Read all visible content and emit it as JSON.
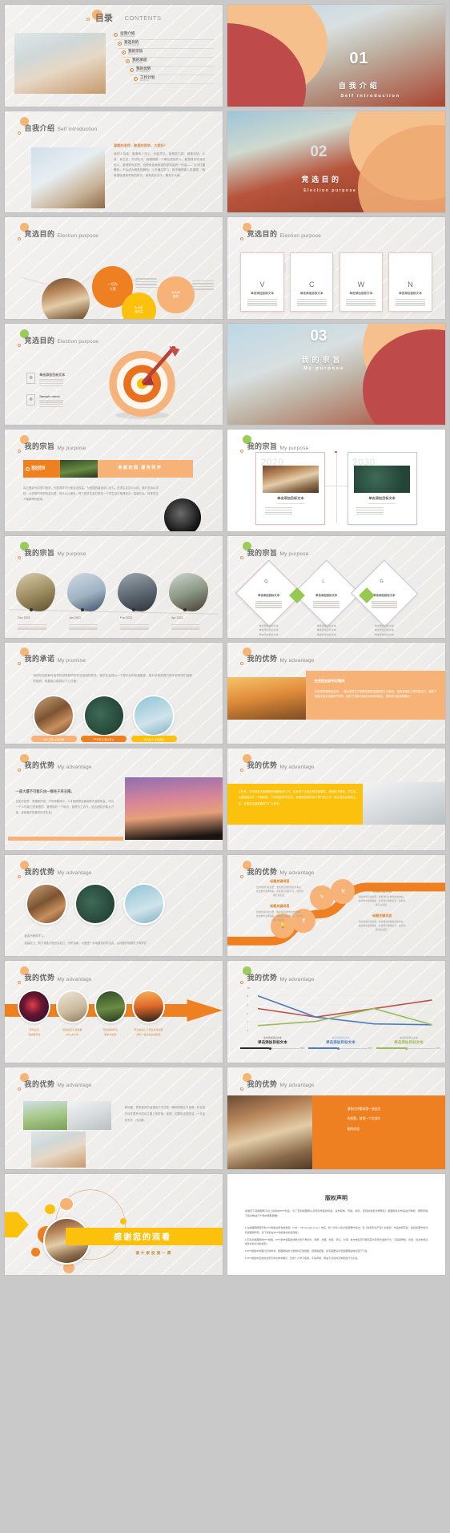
{
  "page": {
    "background": "#c9c9c9",
    "slide_bg": "#efeeec",
    "accent_orange": "#ef8022",
    "accent_light_orange": "#f7b377",
    "accent_yellow": "#fcc10d",
    "accent_green": "#96c94f",
    "accent_red": "#bf4a4a",
    "columns": 2,
    "slide_count": 28
  },
  "placeholder": {
    "target_text": "单击添加目标文本",
    "sample_name": "Sample name",
    "keyword": "标题关键词语",
    "percent": "58%"
  },
  "slides": [
    {
      "id": "s01-contents",
      "title_cn": "目录",
      "title_en": "CONTENTS",
      "items": [
        {
          "cn": "自我介绍",
          "en": "Self introduction"
        },
        {
          "cn": "竞选目的",
          "en": "Election purpose"
        },
        {
          "cn": "我的宗旨",
          "en": "My purpose"
        },
        {
          "cn": "我的承诺",
          "en": "My promise"
        },
        {
          "cn": "我的优势",
          "en": "My advantage"
        },
        {
          "cn": "工作计划",
          "en": "Work plan"
        }
      ]
    },
    {
      "id": "s02-section-01",
      "number": "01",
      "title_cn": "自我介绍",
      "title_en": "Self introduction"
    },
    {
      "id": "s03-self-intro",
      "title_cn": "自我介绍",
      "title_en": "Self introduction",
      "lead": "尊敬的老师，敬爱的同学，大家好！",
      "body": "我的人真诚，做事有上进心，头脑灵活，接受能力强，做事自信、认真，有主见，不怕吃亏，我懂得做一个事业成功的人，能带快乐给身边的人。爱得很有意思，也是促使我有强烈求知欲的一句话——“玉不打磨雕刻，不会成为精美的器物；人不通过学习，就不懂得做人的道理。”我希望能把我学到的知识，用到实际当中，服务于大家。"
    },
    {
      "id": "s04-purpose-circles",
      "title_cn": "竞选目的",
      "title_en": "Election purpose",
      "bubbles": [
        {
          "cn": "一切为\n大家",
          "color": "#ef8022"
        },
        {
          "cn": "为大家\n服务",
          "color": "#f7b377"
        },
        {
          "cn": "为大家\n谋利益",
          "color": "#fcc10d"
        }
      ]
    },
    {
      "id": "s05-purpose-vcwn",
      "title_cn": "竞选目的",
      "title_en": "Election purpose",
      "cards": [
        {
          "letter": "V",
          "ghost": "01",
          "label": "单击添加目标文本"
        },
        {
          "letter": "C",
          "ghost": "02",
          "label": "单击添加目标文本"
        },
        {
          "letter": "W",
          "ghost": "03",
          "label": "单击添加目标文本"
        },
        {
          "letter": "N",
          "ghost": "04",
          "label": "单击添加目标文本"
        }
      ]
    },
    {
      "id": "s06-purpose-target",
      "title_cn": "竞选目的",
      "title_en": "Election purpose",
      "rows": [
        {
          "label": "单击添加目标文本"
        },
        {
          "label": "Sample name"
        }
      ]
    },
    {
      "id": "s07-section-03",
      "number": "03",
      "title_cn": "我的宗旨",
      "title_en": "My purpose"
    },
    {
      "id": "s08-my-purpose-banner",
      "title_cn": "我的宗旨",
      "title_en": "My purpose",
      "badge_cn": "我的宗旨",
      "badge_en": "My purpose",
      "banner_text": "奉献校园   服务同学",
      "body": "真正做到为同学们服务，代表同学们行使合法权益，为校园的建设尽心尽力。在学生会意义以前，我们坚持以学校、大多数同学的利益为重，绝不以公谋私，努力把学生会打造成一个学生自己管理自己、高度自治、体现学生人格精神的团体。"
    },
    {
      "id": "s09-timeline-2020",
      "title_cn": "我的宗旨",
      "title_en": "My purpose",
      "panels": [
        {
          "year": "2020",
          "label": "单击添加目标文本"
        },
        {
          "year": "2030",
          "label": "单击添加目标文本"
        }
      ]
    },
    {
      "id": "s10-photo-timeline",
      "title_cn": "我的宗旨",
      "title_en": "My purpose",
      "points": [
        {
          "date": "Dec 2021"
        },
        {
          "date": "Jan 2021"
        },
        {
          "date": "Feb 2021"
        },
        {
          "date": "Apr 2021"
        }
      ]
    },
    {
      "id": "s11-diamonds-qlg",
      "title_cn": "我的宗旨",
      "title_en": "My purpose",
      "diamonds": [
        {
          "letter": "Q",
          "label": "单击添加目标文本"
        },
        {
          "letter": "L",
          "label": "单击添加目标文本"
        },
        {
          "letter": "G",
          "label": "单击添加目标文本"
        }
      ]
    },
    {
      "id": "s12-promise",
      "title_cn": "我的承诺",
      "title_en": "My promise",
      "body": "我将尽全校和完成学校领导和同学们交给我的任务，使学生会成为一个现代化的积极团体，成为学校的得力助手和同学们信赖的组织，我要用心做到以下几方面：",
      "tags": [
        {
          "text": "待人正直 以正为重",
          "color": "#f7b377"
        },
        {
          "text": "严于利己 宽以待人",
          "color": "#ef8022"
        },
        {
          "text": "乐于助人 甘任重任",
          "color": "#fcc10d"
        }
      ]
    },
    {
      "id": "s13-advantage-orange",
      "title_cn": "我的优势",
      "title_en": "My advantage",
      "panel_title": "在任团支部书记期间",
      "panel_body": "20多项的辩明各活动，一直对我学生干部教育委的加强服务工作热情，提高我落实工作的能动力，锻炼了我独才能主动服务于同学，锻炼了我搞才能成为同学的朋友，更有成为老师的助手！"
    },
    {
      "id": "s14-advantage-pillar",
      "title_cn": "我的优势",
      "title_en": "My advantage",
      "lead": "一座大厦不可能只由一根柱子来支撑。",
      "body": "正如马克思，恩格斯所说，只有再集体中，人才能获得全面发展才能的机会。可见一个人的能力是有限的，要想搞好一个组织，就得分工合作，结合团队的最大力量，进而更好的建设好学生会！"
    },
    {
      "id": "s15-advantage-yellow",
      "title_cn": "我的优势",
      "title_en": "My advantage",
      "body": "三年来，我不进办方面能很好地解我的工作，还负责了大部分的班级事务。我深刻了解到，学生会主席就相当于一只领航员，只有组织好学生会，协调和协调好各个部门的工作，用心完成自身的工作，才能真正做到服务于广大同学。"
    },
    {
      "id": "s16-advantage-circles3",
      "title_cn": "我的优势",
      "title_en": "My advantage",
      "body_line1": "我会不断的学习。",
      "body_line2": "武装自己，努力将各方面充实自己，开拓创新，以便进一步地建设好学生会，从而更好地服务于同学们"
    },
    {
      "id": "s17-advantage-wave",
      "title_cn": "我的优势",
      "title_en": "My advantage",
      "nodes": [
        {
          "icon": "pen-icon",
          "title": "标题关键词语",
          "body": "您的内容打在这里，或者通过复制您的文本后，在此框中选择粘贴，并选择只保留文字，您的内容打在这里。"
        },
        {
          "icon": "wrench-icon",
          "title": "标题关键词语",
          "body": "您的内容打在这里，或者通过复制您的文本后，在此框中选择粘贴，并选择只保留文字，您的内容打在这里。"
        },
        {
          "icon": "bulb-icon",
          "title": "标题关键词语",
          "body": "您的内容打在这里，或者通过复制您的文本后，在此框中选择粘贴，并选择只保留文字，您的内容打在这里。"
        },
        {
          "icon": "hourglass-icon",
          "title": "标题关键词语",
          "body": "您的内容打在这里，或者通过复制您的文本后，在此框中选择粘贴，并选择只保留文字，您的内容打在这里。"
        }
      ]
    },
    {
      "id": "s18-advantage-arrow",
      "title_cn": "我的优势",
      "title_en": "My advantage",
      "steps": [
        {
          "line1": "既然是花",
          "line2": "我就要开放"
        },
        {
          "line1": "既然是石头我就要",
          "line2": "去外出大海"
        },
        {
          "line1": "既然是树我就",
          "line2": "要长成栋梁"
        },
        {
          "line1": "既然是加入了学生会我就要",
          "line2": "成为一名出色的领航员"
        }
      ]
    },
    {
      "id": "s19-advantage-chart",
      "title_cn": "我的优势",
      "title_en": "My advantage",
      "legend": [
        {
          "small": "单击添加目标文本",
          "big": "单击添加目标文本",
          "pct": "58%",
          "color": "#2b2b2b"
        },
        {
          "small": "单击添加目标文本",
          "big": "单击添加目标文本",
          "pct": "58%",
          "color": "#4a7ebb"
        },
        {
          "small": "单击添加目标文本",
          "big": "单击添加目标文本",
          "pct": "58%",
          "color": "#9bbb59"
        }
      ],
      "chart_data": {
        "type": "line",
        "title": "",
        "xlabel": "",
        "ylabel": "",
        "x": [
          1,
          2,
          3,
          4
        ],
        "ylim": [
          0,
          10
        ],
        "yticks": [
          0,
          2,
          4,
          6,
          8,
          10
        ],
        "grid": true,
        "legend_position": "bottom",
        "series": [
          {
            "name": "单击添加目标文本",
            "color": "#c0504d",
            "values": [
              5,
              3,
              5,
              7
            ]
          },
          {
            "name": "单击添加目标文本",
            "color": "#4a7ebb",
            "values": [
              8,
              3,
              1.4,
              1.2
            ]
          },
          {
            "name": "单击添加目标文本",
            "color": "#9bbb59",
            "values": [
              1,
              2,
              5,
              1.2
            ]
          }
        ]
      }
    },
    {
      "id": "s20-advantage-photos",
      "title_cn": "我的优势",
      "title_en": "My advantage",
      "body": "我知道，再多豪言的话语也只不过是一瞬间的雄壮与激情，朴实的行动才是开创成功之路上的阶梯。我想，如果我当选的话，一定会言不托，行必果。"
    },
    {
      "id": "s21-advantage-library",
      "title_cn": "我的优势",
      "title_en": "My advantage",
      "lines": [
        "请各位评委给我一张信任",
        "的投票，给我一个实战才",
        "能的机会!"
      ]
    },
    {
      "id": "s22-thanks",
      "title_cn": "感谢您的观看",
      "subtitle_cn": "请大家投我一票"
    },
    {
      "id": "s23-copyright",
      "title": "版权声明",
      "intro": "感谢您下载摄图网平台上提供的PPT作品，为了您和摄图网以及原创作者的利益，请勿复制、传播、销售，否则将承担法律责任！摄图网将对作品进行维权，按照传播下载次数进行十倍的索取赔偿！",
      "clauses": [
        "1.在摄图网拥有所有PPT模板全部免费版权（VRF：VIP Royalty-Free）作品，受《中华人民共和国著作权法》和《世界知识产权》的保护。作品的所有权、版权和著作权均归摄图网所有，您下载的是PPT模板素材的使用权；",
        "2.不得将摄图网的PPT模板、PPT素材或其组成部分用于再出售、捐赠、出租、出借、转让、分销、发布或任何可能获取为原用方发的行为、不得抵押权、出卖、将这未经议或基本协议中的权利；",
        "3.PPT模板中的图片仅供参考，摄图网提供大量素材正版摄图、结果等配图，如有需要请访至摄图网站地址自行下载；",
        "4.PPT模板中包含的创意字体为参考展示，仅供个人学习使用，不得商用，网站不对您的字体使用行为负责。"
      ]
    }
  ]
}
